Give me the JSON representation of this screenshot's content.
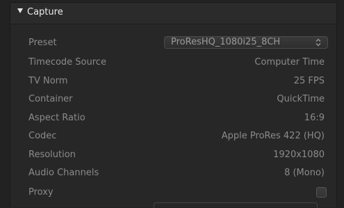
{
  "section": {
    "title": "Capture",
    "expanded": true
  },
  "preset": {
    "label": "Preset",
    "value": "ProResHQ_1080i25_8CH"
  },
  "properties": [
    {
      "label": "Timecode Source",
      "value": "Computer Time"
    },
    {
      "label": "TV Norm",
      "value": "25 FPS"
    },
    {
      "label": "Container",
      "value": "QuickTime"
    },
    {
      "label": "Aspect Ratio",
      "value": "16:9"
    },
    {
      "label": "Codec",
      "value": "Apple ProRes 422 (HQ)"
    },
    {
      "label": "Resolution",
      "value": "1920x1080"
    },
    {
      "label": "Audio Channels",
      "value": "8 (Mono)"
    }
  ],
  "proxy": {
    "label": "Proxy",
    "checked": false
  },
  "icons": {
    "disclosure": "disclosure-triangle-down-icon",
    "select_arrows": "up-down-chevron-icon"
  },
  "colors": {
    "background": "#222222",
    "panel": "#272727",
    "label_text": "#8b8b8b",
    "title_text": "#ececec"
  }
}
